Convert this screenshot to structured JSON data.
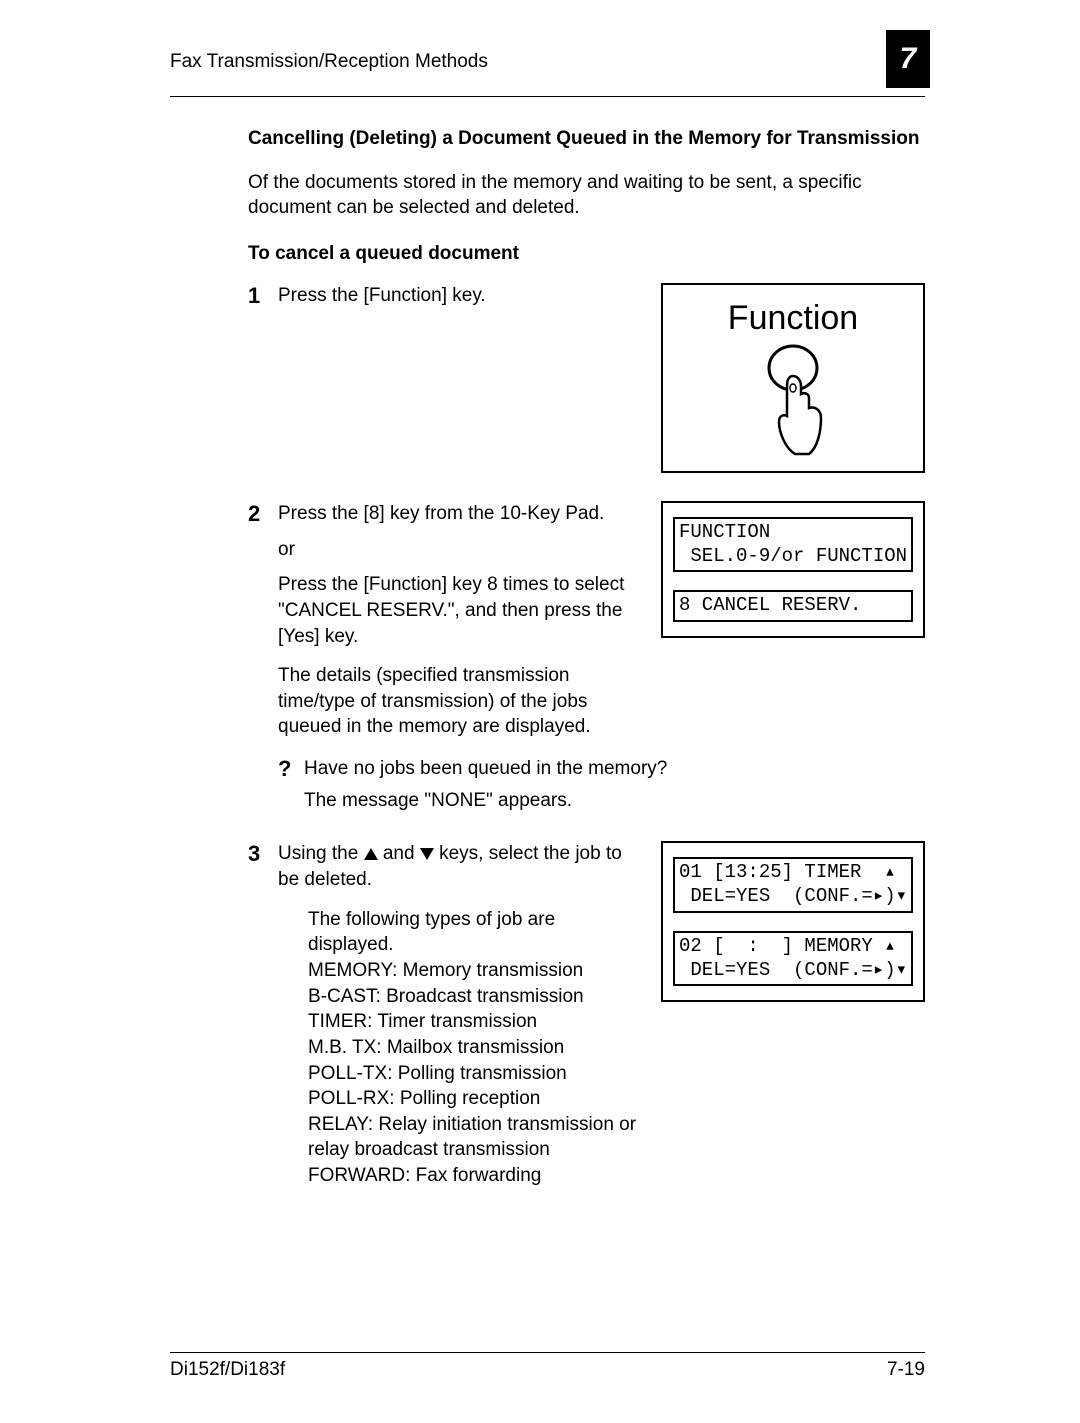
{
  "header": {
    "title": "Fax Transmission/Reception Methods",
    "chapter": "7"
  },
  "section": {
    "title": "Cancelling (Deleting) a Document Queued in the Memory for Transmission",
    "intro": "Of the documents stored in the memory and waiting to be sent, a specific document can be selected and deleted.",
    "sub_title": "To cancel a queued document"
  },
  "steps": {
    "s1": {
      "num": "1",
      "text": "Press the [Function] key.",
      "button_label": "Function"
    },
    "s2": {
      "num": "2",
      "p1": "Press the [8] key from the 10-Key Pad.",
      "p2": "or",
      "p3": "Press the [Function] key 8 times to select \"CANCEL RESERV.\", and then press the [Yes] key.",
      "p4": "The details (specified transmission time/type of transmission) of the jobs queued in the memory are displayed.",
      "q_icon": "?",
      "q1": "Have no jobs been queued in the memory?",
      "q2": "The message \"NONE\" appears.",
      "screen": {
        "line1": "FUNCTION",
        "line2": " SEL.0-9/or FUNCTION",
        "line3": "8 CANCEL RESERV."
      }
    },
    "s3": {
      "num": "3",
      "p1a": "Using the ",
      "p1b": " and ",
      "p1c": " keys, select the job to be deleted.",
      "jobs_intro": "The following types of job are displayed.",
      "jobs": {
        "j1": "MEMORY: Memory transmission",
        "j2": "B-CAST: Broadcast transmission",
        "j3": "TIMER: Timer transmission",
        "j4": "M.B. TX: Mailbox transmission",
        "j5": "POLL-TX: Polling transmission",
        "j6": "POLL-RX: Polling reception",
        "j7": "RELAY: Relay initiation transmission or relay broadcast transmission",
        "j8": "FORWARD: Fax forwarding"
      },
      "screen": {
        "line1": "01 [13:25] TIMER  ▴",
        "line2": " DEL=YES  (CONF.=▸)▾",
        "line3": "02 [  :  ] MEMORY ▴",
        "line4": " DEL=YES  (CONF.=▸)▾"
      }
    }
  },
  "footer": {
    "left": "Di152f/Di183f",
    "right": "7-19"
  }
}
